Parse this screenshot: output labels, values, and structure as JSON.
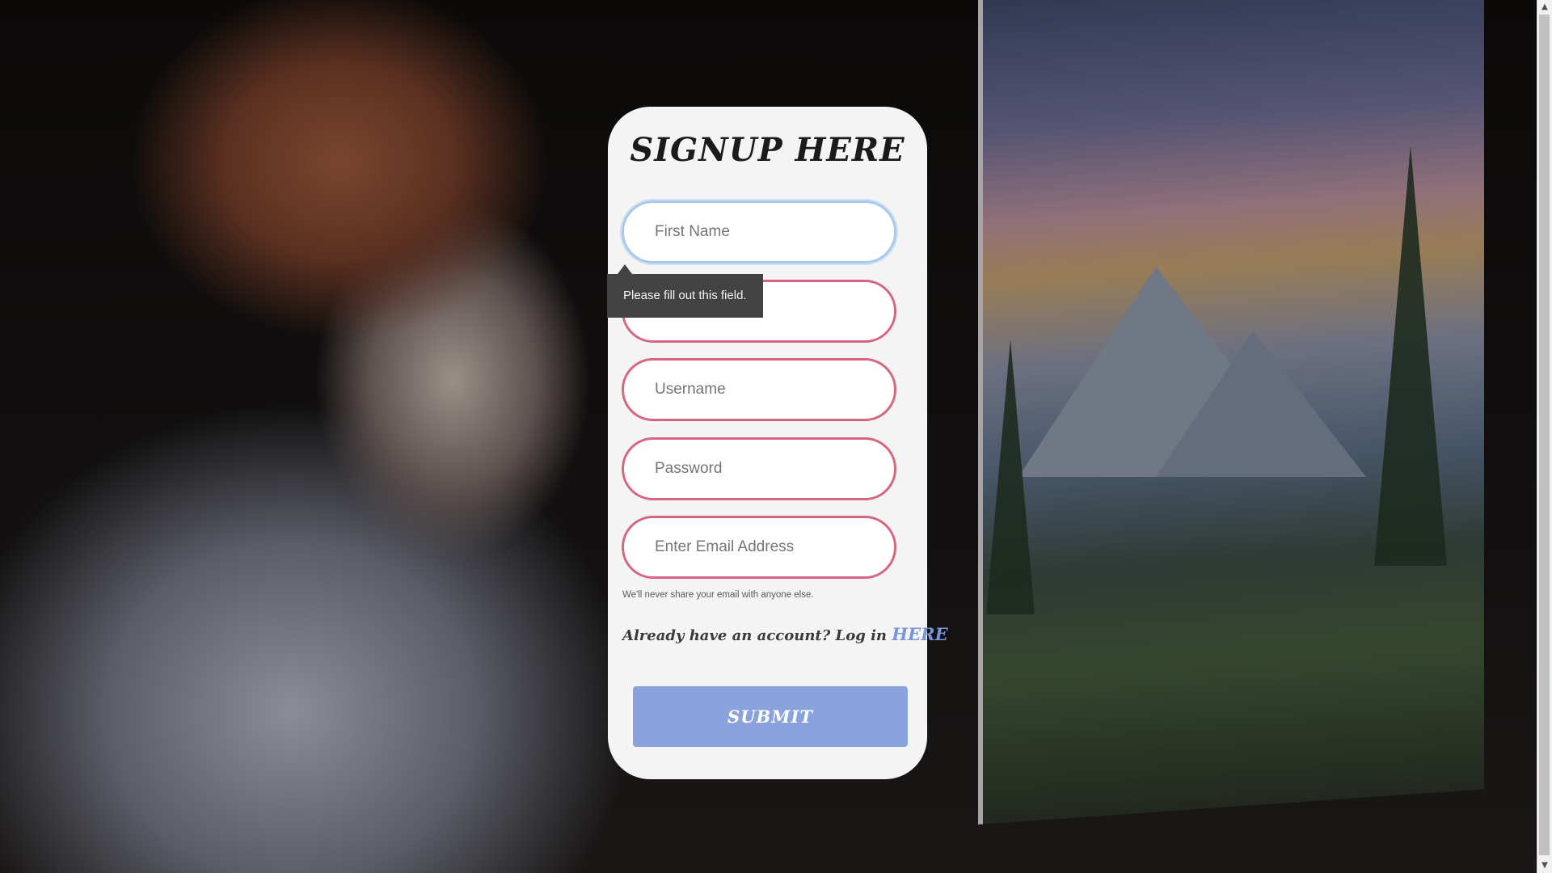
{
  "form": {
    "title": "SIGNUP HERE",
    "fields": {
      "first_name": {
        "placeholder": "First Name",
        "value": ""
      },
      "last_name": {
        "placeholder": "Last Name",
        "value": ""
      },
      "username": {
        "placeholder": "Username",
        "value": ""
      },
      "password": {
        "placeholder": "Password",
        "value": ""
      },
      "email": {
        "placeholder": "Enter Email Address",
        "value": ""
      }
    },
    "email_hint": "We'll never share your email with anyone else.",
    "account_prompt": "Already have an account? Log in",
    "login_link": "HERE",
    "submit_label": "SUBMIT"
  },
  "validation_tooltip": "Please fill out this field.",
  "colors": {
    "card_background": "#f4f4f4",
    "field_border": "#d4667e",
    "focused_border": "#a9c8ea",
    "submit_background": "#8aa3dd",
    "link": "#7b96d8",
    "tooltip_background": "#434343"
  },
  "scrollbar": {
    "up_icon": "scroll-up-arrow-icon",
    "down_icon": "scroll-down-arrow-icon"
  }
}
